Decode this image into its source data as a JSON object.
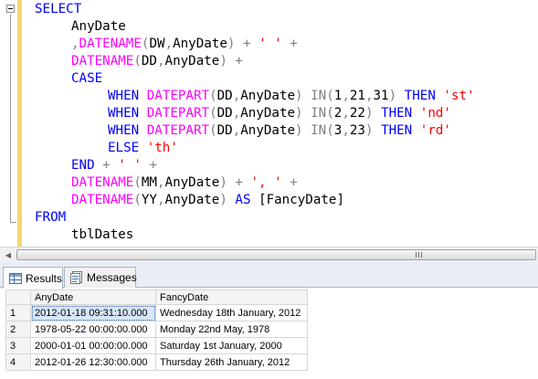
{
  "editor": {
    "lines": [
      [
        {
          "c": "kw",
          "t": "SELECT"
        }
      ],
      [
        {
          "c": "",
          "t": "AnyDate"
        }
      ],
      [
        {
          "c": "op",
          "t": ","
        },
        {
          "c": "fn",
          "t": "DATENAME"
        },
        {
          "c": "op",
          "t": "("
        },
        {
          "c": "",
          "t": "DW"
        },
        {
          "c": "op",
          "t": ","
        },
        {
          "c": "",
          "t": "AnyDate"
        },
        {
          "c": "op",
          "t": ")"
        },
        {
          "c": "",
          "t": " "
        },
        {
          "c": "op",
          "t": "+"
        },
        {
          "c": "",
          "t": " "
        },
        {
          "c": "str",
          "t": "' '"
        },
        {
          "c": "",
          "t": " "
        },
        {
          "c": "op",
          "t": "+"
        }
      ],
      [
        {
          "c": "fn",
          "t": "DATENAME"
        },
        {
          "c": "op",
          "t": "("
        },
        {
          "c": "",
          "t": "DD"
        },
        {
          "c": "op",
          "t": ","
        },
        {
          "c": "",
          "t": "AnyDate"
        },
        {
          "c": "op",
          "t": ")"
        },
        {
          "c": "",
          "t": " "
        },
        {
          "c": "op",
          "t": "+"
        }
      ],
      [
        {
          "c": "kw",
          "t": "CASE"
        }
      ],
      [
        {
          "c": "kw",
          "t": "WHEN"
        },
        {
          "c": "",
          "t": " "
        },
        {
          "c": "fn",
          "t": "DATEPART"
        },
        {
          "c": "op",
          "t": "("
        },
        {
          "c": "",
          "t": "DD"
        },
        {
          "c": "op",
          "t": ","
        },
        {
          "c": "",
          "t": "AnyDate"
        },
        {
          "c": "op",
          "t": ")"
        },
        {
          "c": "",
          "t": " "
        },
        {
          "c": "op",
          "t": "IN"
        },
        {
          "c": "op",
          "t": "("
        },
        {
          "c": "",
          "t": "1"
        },
        {
          "c": "op",
          "t": ","
        },
        {
          "c": "",
          "t": "21"
        },
        {
          "c": "op",
          "t": ","
        },
        {
          "c": "",
          "t": "31"
        },
        {
          "c": "op",
          "t": ")"
        },
        {
          "c": "",
          "t": " "
        },
        {
          "c": "kw",
          "t": "THEN"
        },
        {
          "c": "",
          "t": " "
        },
        {
          "c": "str",
          "t": "'st'"
        }
      ],
      [
        {
          "c": "kw",
          "t": "WHEN"
        },
        {
          "c": "",
          "t": " "
        },
        {
          "c": "fn",
          "t": "DATEPART"
        },
        {
          "c": "op",
          "t": "("
        },
        {
          "c": "",
          "t": "DD"
        },
        {
          "c": "op",
          "t": ","
        },
        {
          "c": "",
          "t": "AnyDate"
        },
        {
          "c": "op",
          "t": ")"
        },
        {
          "c": "",
          "t": " "
        },
        {
          "c": "op",
          "t": "IN"
        },
        {
          "c": "op",
          "t": "("
        },
        {
          "c": "",
          "t": "2"
        },
        {
          "c": "op",
          "t": ","
        },
        {
          "c": "",
          "t": "22"
        },
        {
          "c": "op",
          "t": ")"
        },
        {
          "c": "",
          "t": " "
        },
        {
          "c": "kw",
          "t": "THEN"
        },
        {
          "c": "",
          "t": " "
        },
        {
          "c": "str",
          "t": "'nd'"
        }
      ],
      [
        {
          "c": "kw",
          "t": "WHEN"
        },
        {
          "c": "",
          "t": " "
        },
        {
          "c": "fn",
          "t": "DATEPART"
        },
        {
          "c": "op",
          "t": "("
        },
        {
          "c": "",
          "t": "DD"
        },
        {
          "c": "op",
          "t": ","
        },
        {
          "c": "",
          "t": "AnyDate"
        },
        {
          "c": "op",
          "t": ")"
        },
        {
          "c": "",
          "t": " "
        },
        {
          "c": "op",
          "t": "IN"
        },
        {
          "c": "op",
          "t": "("
        },
        {
          "c": "",
          "t": "3"
        },
        {
          "c": "op",
          "t": ","
        },
        {
          "c": "",
          "t": "23"
        },
        {
          "c": "op",
          "t": ")"
        },
        {
          "c": "",
          "t": " "
        },
        {
          "c": "kw",
          "t": "THEN"
        },
        {
          "c": "",
          "t": " "
        },
        {
          "c": "str",
          "t": "'rd'"
        }
      ],
      [
        {
          "c": "kw",
          "t": "ELSE"
        },
        {
          "c": "",
          "t": " "
        },
        {
          "c": "str",
          "t": "'th'"
        }
      ],
      [
        {
          "c": "kw",
          "t": "END"
        },
        {
          "c": "",
          "t": " "
        },
        {
          "c": "op",
          "t": "+"
        },
        {
          "c": "",
          "t": " "
        },
        {
          "c": "str",
          "t": "' '"
        },
        {
          "c": "",
          "t": " "
        },
        {
          "c": "op",
          "t": "+"
        }
      ],
      [
        {
          "c": "fn",
          "t": "DATENAME"
        },
        {
          "c": "op",
          "t": "("
        },
        {
          "c": "",
          "t": "MM"
        },
        {
          "c": "op",
          "t": ","
        },
        {
          "c": "",
          "t": "AnyDate"
        },
        {
          "c": "op",
          "t": ")"
        },
        {
          "c": "",
          "t": " "
        },
        {
          "c": "op",
          "t": "+"
        },
        {
          "c": "",
          "t": " "
        },
        {
          "c": "str",
          "t": "', '"
        },
        {
          "c": "",
          "t": " "
        },
        {
          "c": "op",
          "t": "+"
        }
      ],
      [
        {
          "c": "fn",
          "t": "DATENAME"
        },
        {
          "c": "op",
          "t": "("
        },
        {
          "c": "",
          "t": "YY"
        },
        {
          "c": "op",
          "t": ","
        },
        {
          "c": "",
          "t": "AnyDate"
        },
        {
          "c": "op",
          "t": ")"
        },
        {
          "c": "",
          "t": " "
        },
        {
          "c": "kw",
          "t": "AS"
        },
        {
          "c": "",
          "t": " "
        },
        {
          "c": "",
          "t": "[FancyDate]"
        }
      ],
      [
        {
          "c": "kw",
          "t": "FROM"
        }
      ],
      [
        {
          "c": "",
          "t": "tblDates"
        }
      ]
    ],
    "colors": {
      "keyword": "#0000ff",
      "function": "#ff00ff",
      "operator": "#808080",
      "string": "#ff0000",
      "change_bar": "#f5d76e"
    }
  },
  "tabs": {
    "results_label": "Results",
    "messages_label": "Messages",
    "results_icon": "grid-icon",
    "messages_icon": "messages-icon"
  },
  "results": {
    "columns": [
      "AnyDate",
      "FancyDate"
    ],
    "rows": [
      {
        "num": "1",
        "anydate": "2012-01-18 09:31:10.000",
        "fancydate": "Wednesday 18th January, 2012"
      },
      {
        "num": "2",
        "anydate": "1978-05-22 00:00:00.000",
        "fancydate": "Monday 22nd May, 1978"
      },
      {
        "num": "3",
        "anydate": "2000-01-01 00:00:00.000",
        "fancydate": "Saturday 1st January, 2000"
      },
      {
        "num": "4",
        "anydate": "2012-01-26 12:30:00.000",
        "fancydate": "Thursday 26th January, 2012"
      }
    ],
    "selected_color": "#d7e6fb"
  }
}
